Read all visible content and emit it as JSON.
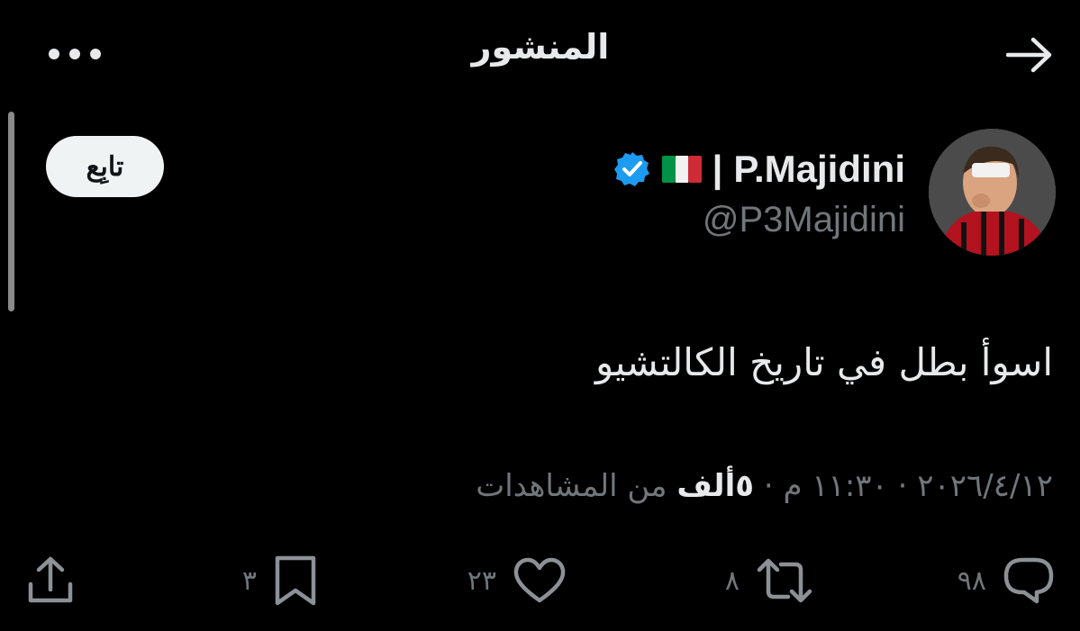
{
  "header": {
    "title": "المنشور",
    "back_icon": "arrow-right-icon",
    "more_icon": "more-horizontal-icon"
  },
  "author": {
    "display_name": "P.Majidini",
    "separator": "|",
    "flag_icon": "italy-flag-icon",
    "verified_icon": "verified-badge-icon",
    "handle": "@P3Majidini",
    "avatar_icon": "avatar"
  },
  "follow_button": {
    "label": "تابِع"
  },
  "tweet": {
    "text": "اسوأ بطل في تاريخ الكالتشيو"
  },
  "meta": {
    "date": "٢٠٢٦/٤/١٢",
    "dot1": "·",
    "time": "١١:٣٠ م",
    "dot2": "·",
    "views_count": "٥ألف",
    "views_label": "من المشاهدات"
  },
  "actions": {
    "replies": {
      "icon": "reply-icon",
      "count": "٩٨"
    },
    "retweets": {
      "icon": "retweet-icon",
      "count": "٨"
    },
    "likes": {
      "icon": "heart-icon",
      "count": "٢٣"
    },
    "bookmarks": {
      "icon": "bookmark-icon",
      "count": "٣"
    },
    "share": {
      "icon": "share-icon"
    }
  },
  "colors": {
    "background": "#000000",
    "primary_text": "#e7e9ea",
    "secondary_text": "#71767b",
    "verified_blue": "#1d9bf0",
    "follow_bg": "#eff3f4"
  }
}
